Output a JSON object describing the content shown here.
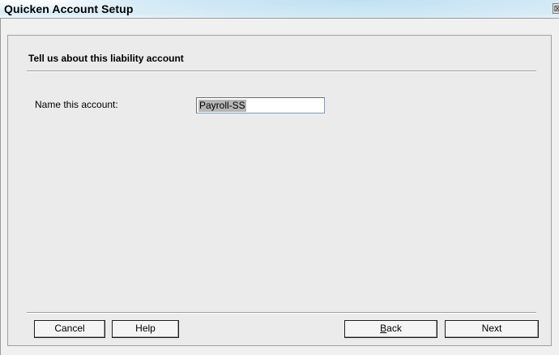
{
  "window": {
    "title": "Quicken Account Setup",
    "close_glyph": "⊠"
  },
  "panel": {
    "heading": "Tell us about this liability account",
    "fields": {
      "account_name": {
        "label": "Name this account:",
        "value": "Payroll-SS"
      }
    }
  },
  "buttons": {
    "cancel": "Cancel",
    "help": "Help",
    "back_mnemonic": "B",
    "back_rest": "ack",
    "next": "Next"
  },
  "colors": {
    "titlebar_accent": "#d6ebf6",
    "panel_background": "#ebebeb",
    "window_background": "#f0f0f0",
    "selection_highlight": "#b5b5b5"
  }
}
